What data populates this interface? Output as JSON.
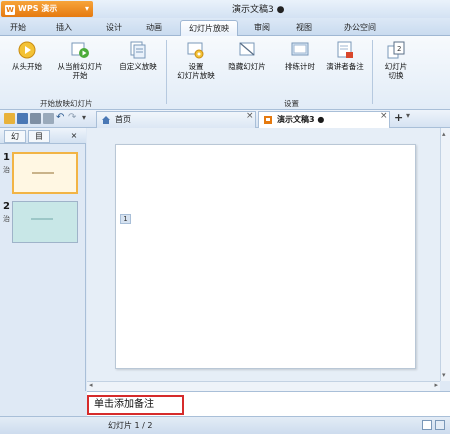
{
  "app": {
    "name": "WPS 演示",
    "logo_letter": "W"
  },
  "window": {
    "title": "演示文稿3 ●"
  },
  "menu": {
    "tabs": [
      {
        "label": "开始"
      },
      {
        "label": "插入"
      },
      {
        "label": "设计"
      },
      {
        "label": "动画"
      },
      {
        "label": "幻灯片放映",
        "active": true
      },
      {
        "label": "审阅"
      },
      {
        "label": "视图"
      },
      {
        "label": "办公空间"
      }
    ]
  },
  "ribbon": {
    "buttons": {
      "from_start": "从头开始",
      "from_current_1": "从当前幻灯片",
      "from_current_2": "开始",
      "custom_show": "自定义放映",
      "setup_1": "设置",
      "setup_2": "幻灯片放映",
      "hide_slide": "隐藏幻灯片",
      "rehearse": "排练计时",
      "presenter_notes": "演讲者备注",
      "switch_1": "幻灯片",
      "switch_2": "切换"
    },
    "groups": {
      "start_show": "开始放映幻灯片",
      "setup": "设置"
    }
  },
  "tabs_row": {
    "home_tab": "首页",
    "doc_tab": "演示文稿3 ●",
    "close": "×",
    "add": "+"
  },
  "left_pane": {
    "tabs": [
      "幻",
      "目"
    ],
    "slides": [
      {
        "number": "1",
        "sub": "治"
      },
      {
        "number": "2",
        "sub": "治"
      }
    ]
  },
  "editor": {
    "placeholder_marker": "1"
  },
  "notes": {
    "placeholder": "单击添加备注"
  },
  "status": {
    "slide_info": "幻灯片 1 / 2"
  },
  "colors": {
    "accent_orange": "#e57a10",
    "notes_highlight": "#d62b2b",
    "thumb2_bg": "#c8e7e7"
  }
}
